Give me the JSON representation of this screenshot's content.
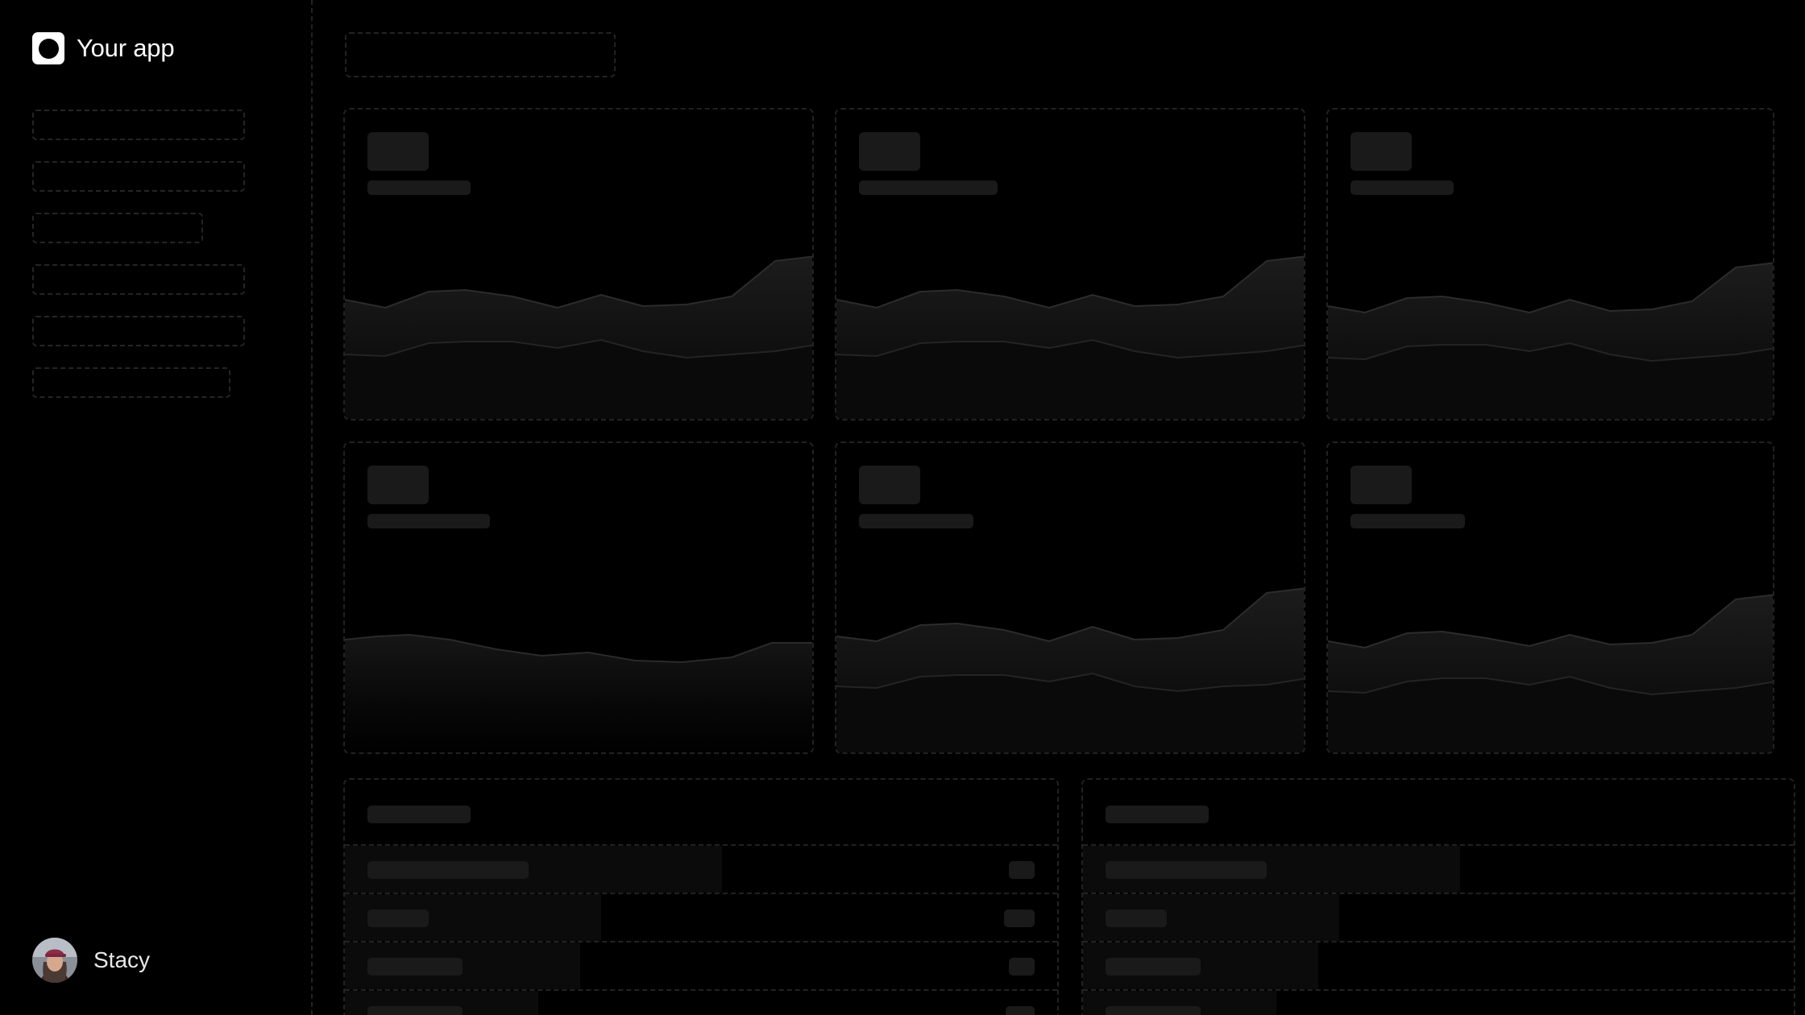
{
  "app": {
    "name": "Your app"
  },
  "user": {
    "name": "Stacy"
  },
  "nav": {
    "item_count": 6
  },
  "colors": {
    "background": "#000000",
    "placeholder": "#1a1a1a",
    "dashed_border": "#232323"
  }
}
